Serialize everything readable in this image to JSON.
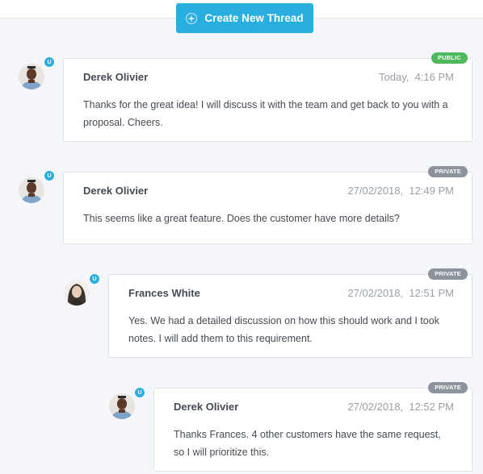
{
  "toolbar": {
    "create_thread_label": "Create New Thread",
    "accent_color": "#29aee0"
  },
  "user_badge": "U",
  "threads": [
    {
      "author": "Derek Olivier",
      "timestamp": "Today,  4:16 PM",
      "visibility": "PUBLIC",
      "message": "Thanks for the great idea! I will discuss it with the team and get back to you with a proposal. Cheers."
    },
    {
      "author": "Derek Olivier",
      "timestamp": "27/02/2018,  12:49 PM",
      "visibility": "PRIVATE",
      "message": "This seems like a great feature. Does the customer have more details?"
    },
    {
      "author": "Frances White",
      "timestamp": "27/02/2018,  12:51 PM",
      "visibility": "PRIVATE",
      "message": "Yes. We had a detailed discussion on how this should work and I took notes. I will add them to this requirement."
    },
    {
      "author": "Derek Olivier",
      "timestamp": "27/02/2018,  12:52 PM",
      "visibility": "PRIVATE",
      "message": "Thanks Frances. 4 other customers have the same request, so I will prioritize this."
    }
  ]
}
